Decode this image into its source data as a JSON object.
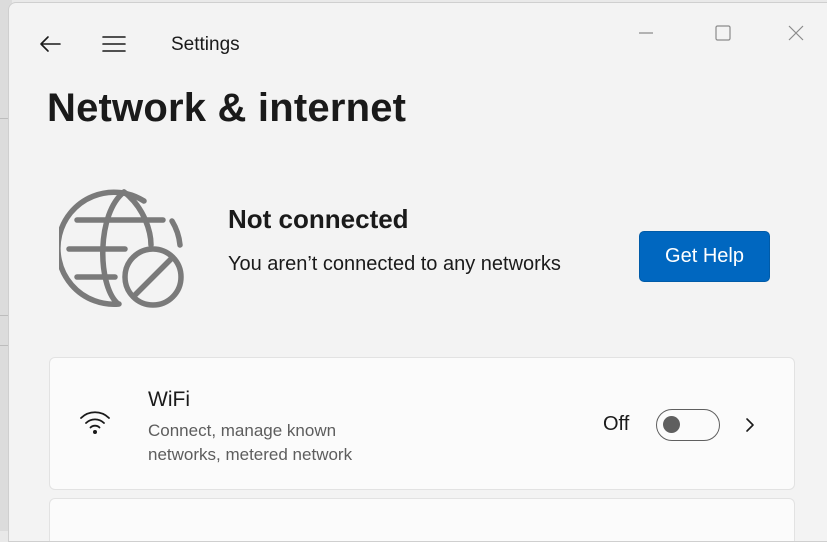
{
  "window": {
    "app_title": "Settings",
    "controls": {
      "minimize_icon": "minimize-icon",
      "maximize_icon": "maximize-icon",
      "close_icon": "close-icon"
    }
  },
  "nav": {
    "back_icon": "back-arrow-icon",
    "menu_icon": "hamburger-menu-icon"
  },
  "page": {
    "title": "Network & internet"
  },
  "status": {
    "icon": "globe-blocked-icon",
    "title": "Not connected",
    "subtitle": "You aren’t connected to any networks",
    "help_button": "Get Help"
  },
  "settings": [
    {
      "icon": "wifi-icon",
      "title": "WiFi",
      "description": "Connect, manage known networks, metered network",
      "toggle_label": "Off",
      "toggle_on": false
    }
  ],
  "colors": {
    "accent": "#0067c0",
    "window_bg": "#f3f3f3",
    "card_bg": "#fbfbfb",
    "secondary_text": "#5d5d5d"
  }
}
